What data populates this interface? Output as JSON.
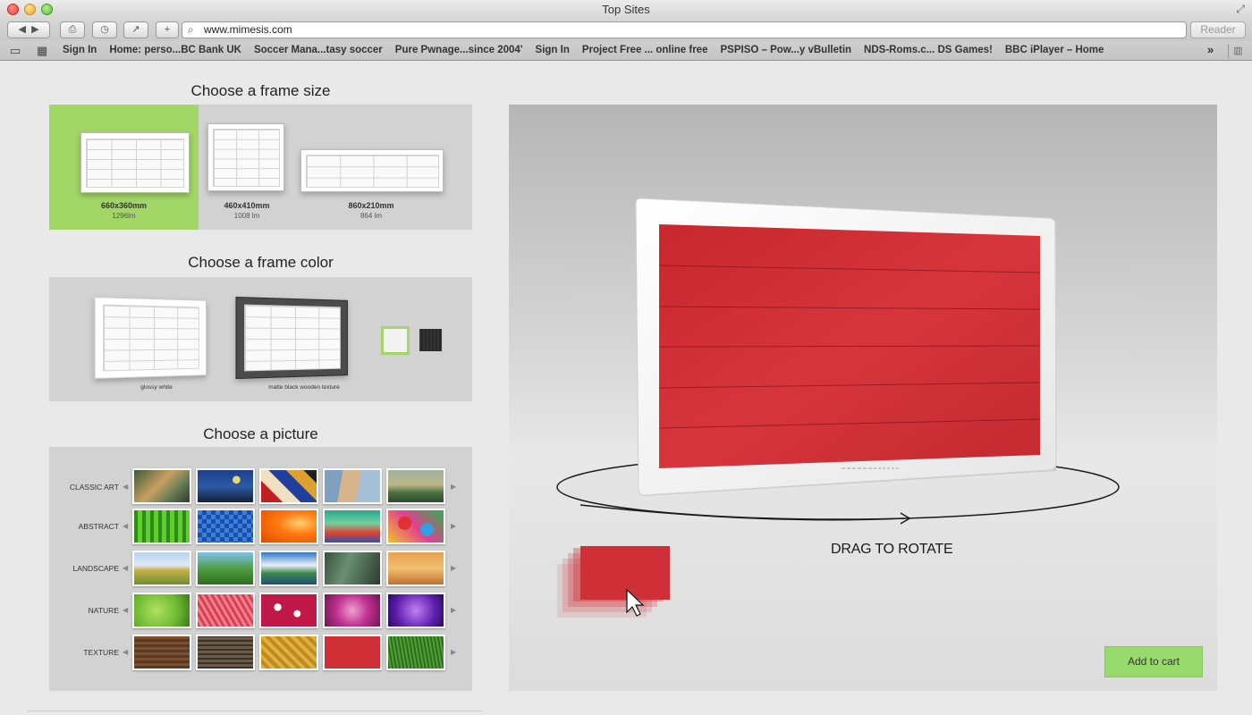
{
  "window": {
    "title": "Top Sites"
  },
  "toolbar": {
    "url": "www.mimesis.com",
    "reader_label": "Reader"
  },
  "bookmarks": [
    "Sign In",
    "Home: perso...BC Bank UK",
    "Soccer Mana...tasy soccer",
    "Pure Pwnage...since 2004'",
    "Sign In",
    "Project Free ... online free",
    "PSPISO – Pow...y vBulletin",
    "NDS-Roms.c... DS Games!",
    "BBC iPlayer – Home"
  ],
  "sections": {
    "size_title": "Choose a frame size",
    "color_title": "Choose a frame color",
    "picture_title": "Choose a picture"
  },
  "sizes": [
    {
      "label": "660x360mm",
      "sub": "1296lm",
      "selected": true
    },
    {
      "label": "460x410mm",
      "sub": "1008 lm",
      "selected": false
    },
    {
      "label": "860x210mm",
      "sub": "864 lm",
      "selected": false
    }
  ],
  "colors": [
    {
      "caption": "glossy white",
      "hex": "#f3f3f3",
      "selected": true
    },
    {
      "caption": "matte black wooden texture",
      "hex": "#2d2d2d",
      "selected": false
    }
  ],
  "categories": [
    "CLASSIC ART",
    "ABSTRACT",
    "LANDSCAPE",
    "NATURE",
    "TEXTURE"
  ],
  "colors_theme": {
    "accent_green": "#a2d667",
    "button_green": "#98db6c",
    "felt_red": "#cf2f36"
  },
  "preview": {
    "drag_label": "DRAG TO ROTATE",
    "cart_label": "Add to cart"
  }
}
